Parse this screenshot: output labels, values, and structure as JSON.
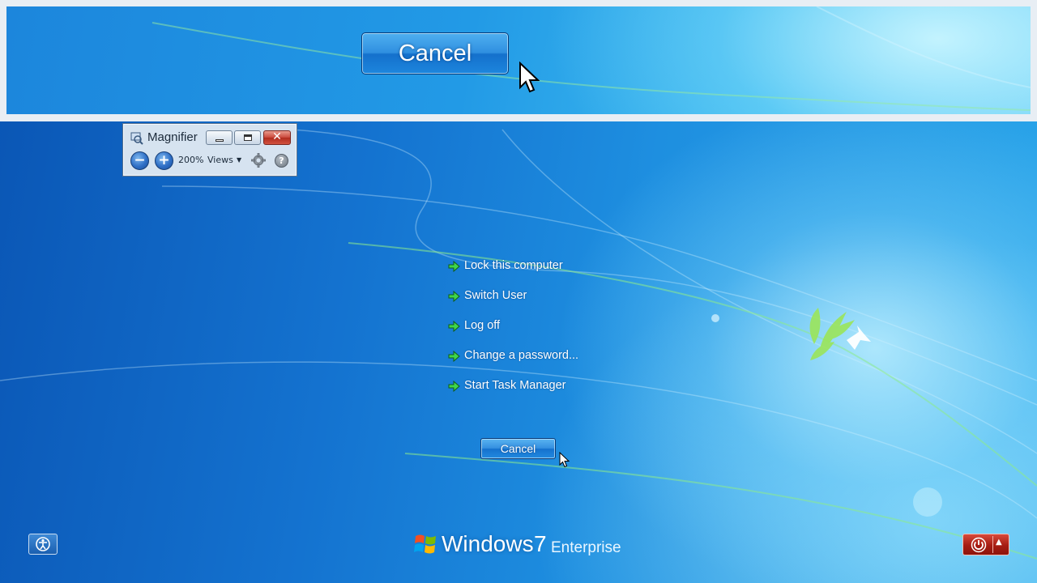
{
  "magnifier_view": {
    "cancel_label": "Cancel"
  },
  "magnifier_window": {
    "title": "Magnifier",
    "zoom_out_icon": "minus-icon",
    "zoom_in_icon": "plus-icon",
    "zoom_level": "200%",
    "views_label": "Views",
    "settings_icon": "gear-icon",
    "help_icon": "help-icon"
  },
  "options": [
    {
      "label": "Lock this computer"
    },
    {
      "label": "Switch User"
    },
    {
      "label": "Log off"
    },
    {
      "label": "Change a password..."
    },
    {
      "label": "Start Task Manager"
    }
  ],
  "cancel_label": "Cancel",
  "branding": {
    "product": "Windows",
    "version": "7",
    "edition": "Enterprise"
  },
  "icons": {
    "ease_of_access": "ease-of-access-icon",
    "power": "power-icon",
    "arrow": "green-arrow-icon"
  },
  "colors": {
    "background": "#1473d0",
    "power_button": "#b0241a",
    "arrow": "#3fd64a"
  }
}
